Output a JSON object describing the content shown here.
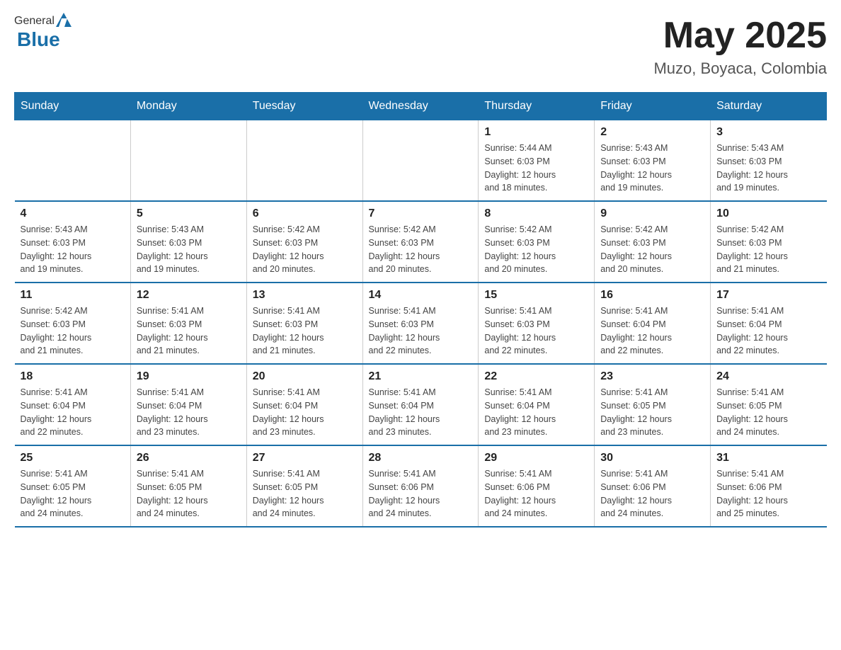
{
  "header": {
    "logo": {
      "general": "General",
      "blue": "Blue"
    },
    "title": "May 2025",
    "location": "Muzo, Boyaca, Colombia"
  },
  "weekdays": [
    "Sunday",
    "Monday",
    "Tuesday",
    "Wednesday",
    "Thursday",
    "Friday",
    "Saturday"
  ],
  "weeks": [
    [
      {
        "day": "",
        "info": ""
      },
      {
        "day": "",
        "info": ""
      },
      {
        "day": "",
        "info": ""
      },
      {
        "day": "",
        "info": ""
      },
      {
        "day": "1",
        "info": "Sunrise: 5:44 AM\nSunset: 6:03 PM\nDaylight: 12 hours\nand 18 minutes."
      },
      {
        "day": "2",
        "info": "Sunrise: 5:43 AM\nSunset: 6:03 PM\nDaylight: 12 hours\nand 19 minutes."
      },
      {
        "day": "3",
        "info": "Sunrise: 5:43 AM\nSunset: 6:03 PM\nDaylight: 12 hours\nand 19 minutes."
      }
    ],
    [
      {
        "day": "4",
        "info": "Sunrise: 5:43 AM\nSunset: 6:03 PM\nDaylight: 12 hours\nand 19 minutes."
      },
      {
        "day": "5",
        "info": "Sunrise: 5:43 AM\nSunset: 6:03 PM\nDaylight: 12 hours\nand 19 minutes."
      },
      {
        "day": "6",
        "info": "Sunrise: 5:42 AM\nSunset: 6:03 PM\nDaylight: 12 hours\nand 20 minutes."
      },
      {
        "day": "7",
        "info": "Sunrise: 5:42 AM\nSunset: 6:03 PM\nDaylight: 12 hours\nand 20 minutes."
      },
      {
        "day": "8",
        "info": "Sunrise: 5:42 AM\nSunset: 6:03 PM\nDaylight: 12 hours\nand 20 minutes."
      },
      {
        "day": "9",
        "info": "Sunrise: 5:42 AM\nSunset: 6:03 PM\nDaylight: 12 hours\nand 20 minutes."
      },
      {
        "day": "10",
        "info": "Sunrise: 5:42 AM\nSunset: 6:03 PM\nDaylight: 12 hours\nand 21 minutes."
      }
    ],
    [
      {
        "day": "11",
        "info": "Sunrise: 5:42 AM\nSunset: 6:03 PM\nDaylight: 12 hours\nand 21 minutes."
      },
      {
        "day": "12",
        "info": "Sunrise: 5:41 AM\nSunset: 6:03 PM\nDaylight: 12 hours\nand 21 minutes."
      },
      {
        "day": "13",
        "info": "Sunrise: 5:41 AM\nSunset: 6:03 PM\nDaylight: 12 hours\nand 21 minutes."
      },
      {
        "day": "14",
        "info": "Sunrise: 5:41 AM\nSunset: 6:03 PM\nDaylight: 12 hours\nand 22 minutes."
      },
      {
        "day": "15",
        "info": "Sunrise: 5:41 AM\nSunset: 6:03 PM\nDaylight: 12 hours\nand 22 minutes."
      },
      {
        "day": "16",
        "info": "Sunrise: 5:41 AM\nSunset: 6:04 PM\nDaylight: 12 hours\nand 22 minutes."
      },
      {
        "day": "17",
        "info": "Sunrise: 5:41 AM\nSunset: 6:04 PM\nDaylight: 12 hours\nand 22 minutes."
      }
    ],
    [
      {
        "day": "18",
        "info": "Sunrise: 5:41 AM\nSunset: 6:04 PM\nDaylight: 12 hours\nand 22 minutes."
      },
      {
        "day": "19",
        "info": "Sunrise: 5:41 AM\nSunset: 6:04 PM\nDaylight: 12 hours\nand 23 minutes."
      },
      {
        "day": "20",
        "info": "Sunrise: 5:41 AM\nSunset: 6:04 PM\nDaylight: 12 hours\nand 23 minutes."
      },
      {
        "day": "21",
        "info": "Sunrise: 5:41 AM\nSunset: 6:04 PM\nDaylight: 12 hours\nand 23 minutes."
      },
      {
        "day": "22",
        "info": "Sunrise: 5:41 AM\nSunset: 6:04 PM\nDaylight: 12 hours\nand 23 minutes."
      },
      {
        "day": "23",
        "info": "Sunrise: 5:41 AM\nSunset: 6:05 PM\nDaylight: 12 hours\nand 23 minutes."
      },
      {
        "day": "24",
        "info": "Sunrise: 5:41 AM\nSunset: 6:05 PM\nDaylight: 12 hours\nand 24 minutes."
      }
    ],
    [
      {
        "day": "25",
        "info": "Sunrise: 5:41 AM\nSunset: 6:05 PM\nDaylight: 12 hours\nand 24 minutes."
      },
      {
        "day": "26",
        "info": "Sunrise: 5:41 AM\nSunset: 6:05 PM\nDaylight: 12 hours\nand 24 minutes."
      },
      {
        "day": "27",
        "info": "Sunrise: 5:41 AM\nSunset: 6:05 PM\nDaylight: 12 hours\nand 24 minutes."
      },
      {
        "day": "28",
        "info": "Sunrise: 5:41 AM\nSunset: 6:06 PM\nDaylight: 12 hours\nand 24 minutes."
      },
      {
        "day": "29",
        "info": "Sunrise: 5:41 AM\nSunset: 6:06 PM\nDaylight: 12 hours\nand 24 minutes."
      },
      {
        "day": "30",
        "info": "Sunrise: 5:41 AM\nSunset: 6:06 PM\nDaylight: 12 hours\nand 24 minutes."
      },
      {
        "day": "31",
        "info": "Sunrise: 5:41 AM\nSunset: 6:06 PM\nDaylight: 12 hours\nand 25 minutes."
      }
    ]
  ]
}
